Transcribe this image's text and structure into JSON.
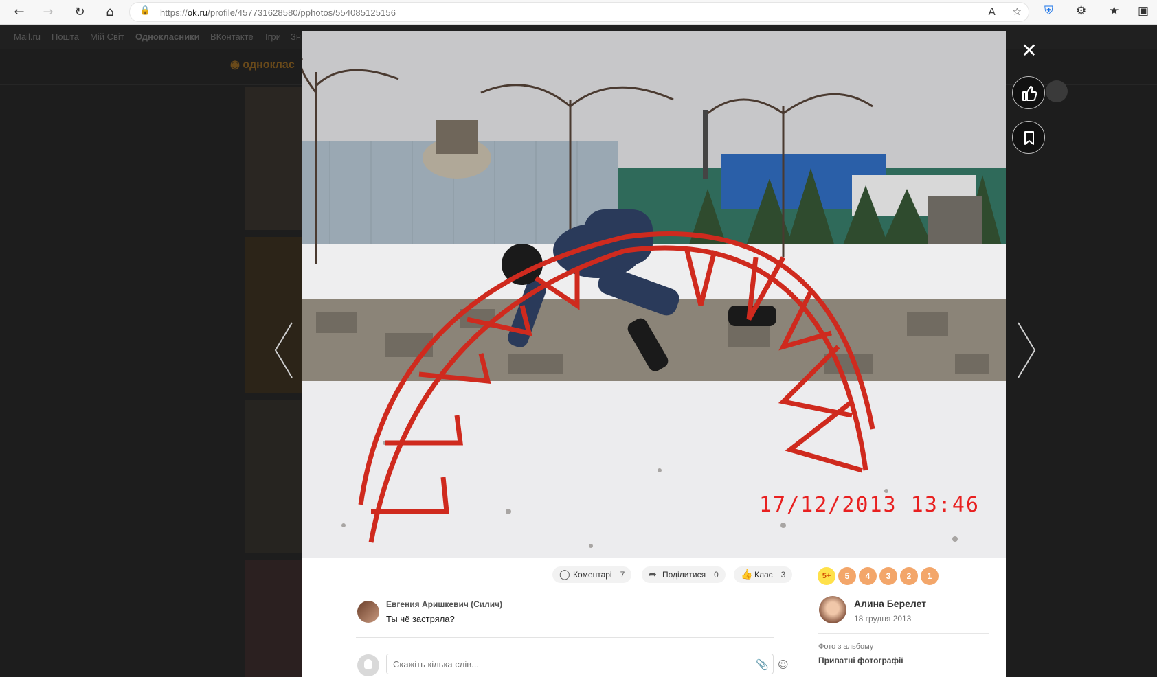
{
  "browser": {
    "url_prefix": "https://",
    "url_host": "ok.ru",
    "url_path": "/profile/457731628580/pphotos/554085125156"
  },
  "portal": {
    "links": [
      "Mail.ru",
      "Пошта",
      "Мій Світ",
      "Однокласники",
      "ВКонтакте",
      "Ігри",
      "Зн"
    ],
    "logo_text": "одноклас"
  },
  "photo": {
    "date_stamp": "17/12/2013  13:46"
  },
  "actions": {
    "comments_label": "Коментарі",
    "comments_count": "7",
    "share_label": "Поділитися",
    "share_count": "0",
    "like_label": "Клас",
    "like_count": "3"
  },
  "ratings": [
    "5+",
    "5",
    "4",
    "3",
    "2",
    "1"
  ],
  "comment": {
    "author": "Евгения Аришкевич (Силич)",
    "text": "Ты чё застряла?"
  },
  "comment_input": {
    "placeholder": "Скажіть кілька слів..."
  },
  "author": {
    "name": "Алина Берелет",
    "date": "18 грудня 2013"
  },
  "album": {
    "label": "Фото з альбому",
    "name": "Приватні фотографії"
  },
  "icons": {
    "close": "close-icon",
    "like": "thumbs-up-icon",
    "bookmark": "bookmark-icon",
    "prev": "chevron-left-icon",
    "next": "chevron-right-icon"
  }
}
